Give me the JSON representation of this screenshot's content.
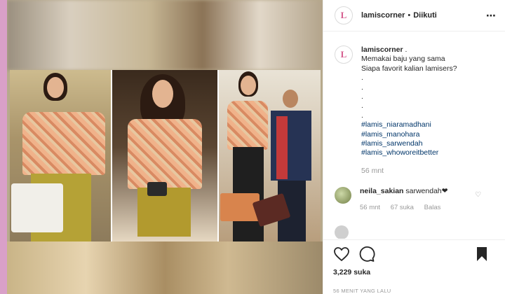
{
  "header": {
    "avatar_letter": "L",
    "username": "lamiscorner",
    "separator": "•",
    "follow_status": "Diikuti",
    "more_icon": "⋯"
  },
  "caption": {
    "username": "lamiscorner",
    "text_1": " .",
    "line_1": "Memakai baju yang sama",
    "line_2": "",
    "line_3": "Siapa favorit kalian lamisers?",
    "dots": [
      ".",
      ".",
      ".",
      ".",
      "."
    ],
    "hashtags": [
      "#lamis_niaramadhani",
      "#lamis_manohara",
      "#lamis_sarwendah",
      "#lamis_whoworeitbetter"
    ],
    "time": "56 mnt"
  },
  "comments": [
    {
      "username": "neila_sakian",
      "text": " sarwendah❤",
      "time": "56 mnt",
      "likes": "67 suka",
      "reply": "Balas"
    }
  ],
  "actions": {
    "like_icon": "heart-icon",
    "comment_icon": "comment-icon",
    "save_icon": "bookmark-icon"
  },
  "likes_count": "3,229 suka",
  "post_time": "56 MENIT YANG LALU",
  "colors": {
    "background": "#d9a0c8",
    "link": "#003569",
    "muted": "#999999"
  }
}
